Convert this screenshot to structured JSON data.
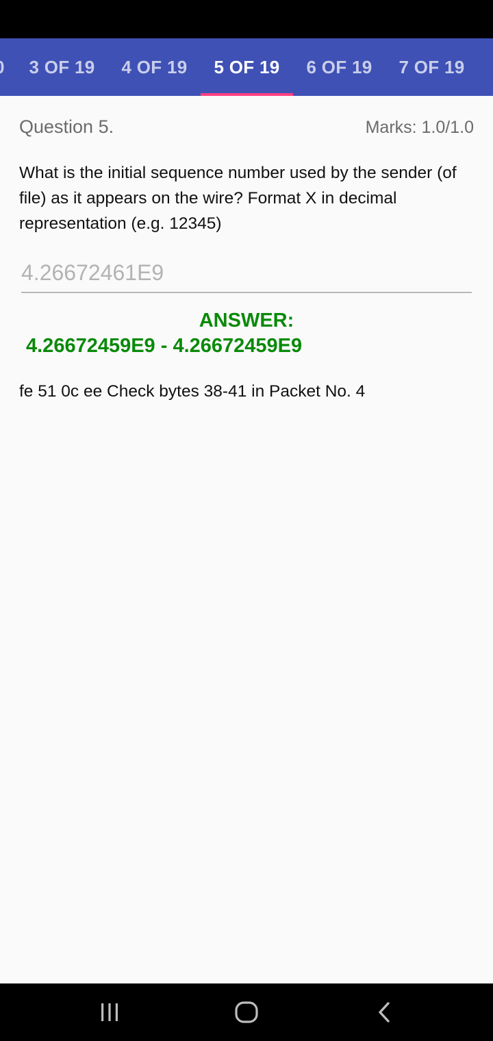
{
  "tabs": {
    "partial_label": "0",
    "items": [
      {
        "label": "3 OF 19"
      },
      {
        "label": "4 OF 19"
      },
      {
        "label": "5 OF 19"
      },
      {
        "label": "6 OF 19"
      },
      {
        "label": "7 OF 19"
      }
    ],
    "active_index": 2
  },
  "question": {
    "title": "Question 5.",
    "marks": "Marks: 1.0/1.0",
    "text": "What is the initial sequence number used by the sender (of file) as it appears on the wire? Format X in decimal representation (e.g. 12345)",
    "response": "4.26672461E9",
    "answer_label": "ANSWER:",
    "answer_range": "4.26672459E9 - 4.26672459E9",
    "hint": "fe 51 0c ee Check bytes 38-41 in Packet No. 4"
  },
  "navigation": {
    "recents_icon": "recents-icon",
    "home_icon": "home-icon",
    "back_icon": "back-icon"
  },
  "colors": {
    "tab_bar": "#3f51b5",
    "tab_indicator": "#ff4081",
    "correct_answer": "#0a8a0a"
  }
}
